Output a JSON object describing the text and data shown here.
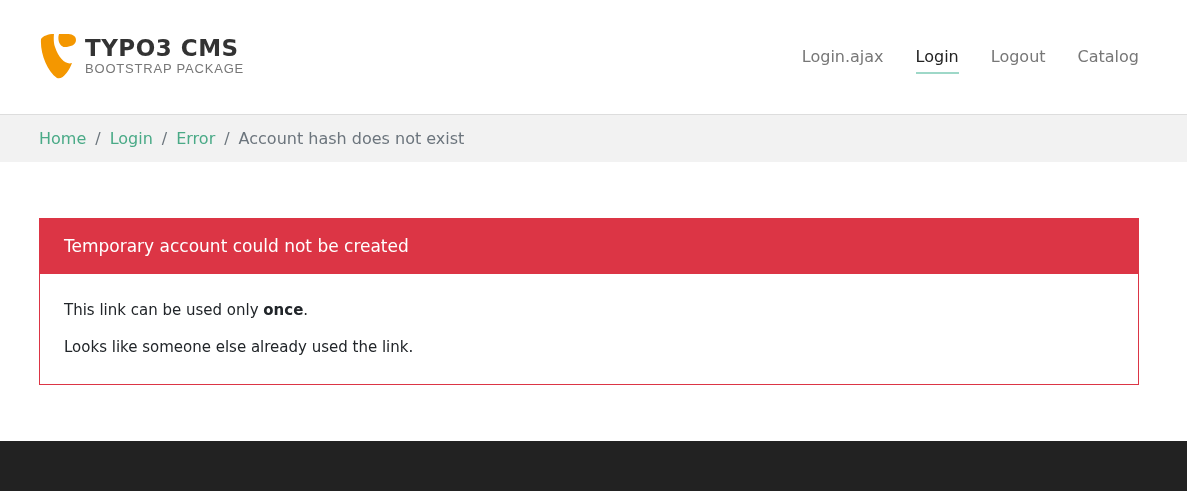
{
  "header": {
    "logo": {
      "title": "TYPO3 CMS",
      "subtitle": "BOOTSTRAP PACKAGE"
    },
    "nav": [
      {
        "label": "Login.ajax",
        "selected": false
      },
      {
        "label": "Login",
        "selected": true
      },
      {
        "label": "Logout",
        "selected": false
      },
      {
        "label": "Catalog",
        "selected": false
      }
    ]
  },
  "breadcrumb": {
    "separator": "/",
    "items": [
      {
        "label": "Home",
        "current": false
      },
      {
        "label": "Login",
        "current": false
      },
      {
        "label": "Error",
        "current": false
      },
      {
        "label": "Account hash does not exist",
        "current": true
      }
    ]
  },
  "alert": {
    "kind": "danger",
    "title": "Temporary account could not be created",
    "paragraphs": [
      "This link can be used only **once**.",
      "Looks like someone else already used the link."
    ]
  }
}
